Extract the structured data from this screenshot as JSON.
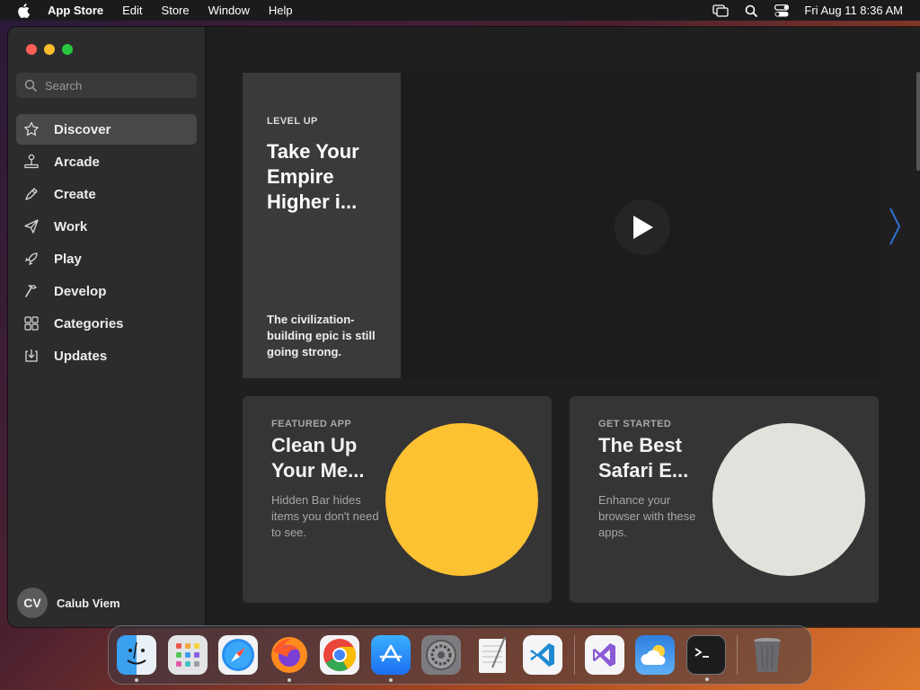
{
  "menubar": {
    "app_name": "App Store",
    "menus": [
      "Edit",
      "Store",
      "Window",
      "Help"
    ],
    "datetime": "Fri Aug 11  8:36 AM",
    "icons": [
      "screen-mirroring-icon",
      "search-icon",
      "control-center-icon"
    ]
  },
  "sidebar": {
    "search_placeholder": "Search",
    "items": [
      {
        "label": "Discover",
        "icon": "star-icon",
        "active": true
      },
      {
        "label": "Arcade",
        "icon": "joystick-icon"
      },
      {
        "label": "Create",
        "icon": "brush-icon"
      },
      {
        "label": "Work",
        "icon": "paper-plane-icon"
      },
      {
        "label": "Play",
        "icon": "rocket-icon"
      },
      {
        "label": "Develop",
        "icon": "hammer-icon"
      },
      {
        "label": "Categories",
        "icon": "grid-icon"
      },
      {
        "label": "Updates",
        "icon": "download-icon"
      }
    ],
    "user": {
      "initials": "CV",
      "name": "Calub Viem"
    }
  },
  "hero": {
    "eyebrow": "LEVEL UP",
    "title": "Take Your Empire Higher i...",
    "description": "The civilization-building epic is still going strong."
  },
  "cards": [
    {
      "eyebrow": "FEATURED APP",
      "title": "Clean Up Your Me...",
      "description": "Hidden Bar hides items you don't need to see.",
      "circle_color": "#fdc232"
    },
    {
      "eyebrow": "GET STARTED",
      "title": "The Best Safari E...",
      "description": "Enhance your browser with these apps.",
      "circle_color": "#dfe3dc"
    }
  ],
  "dock": {
    "apps": [
      "Finder",
      "Launchpad",
      "Safari",
      "Firefox",
      "Chrome",
      "App Store",
      "System Settings",
      "TextEdit",
      "VS Code",
      "Visual Studio",
      "Weather",
      "Terminal",
      "Trash"
    ]
  }
}
